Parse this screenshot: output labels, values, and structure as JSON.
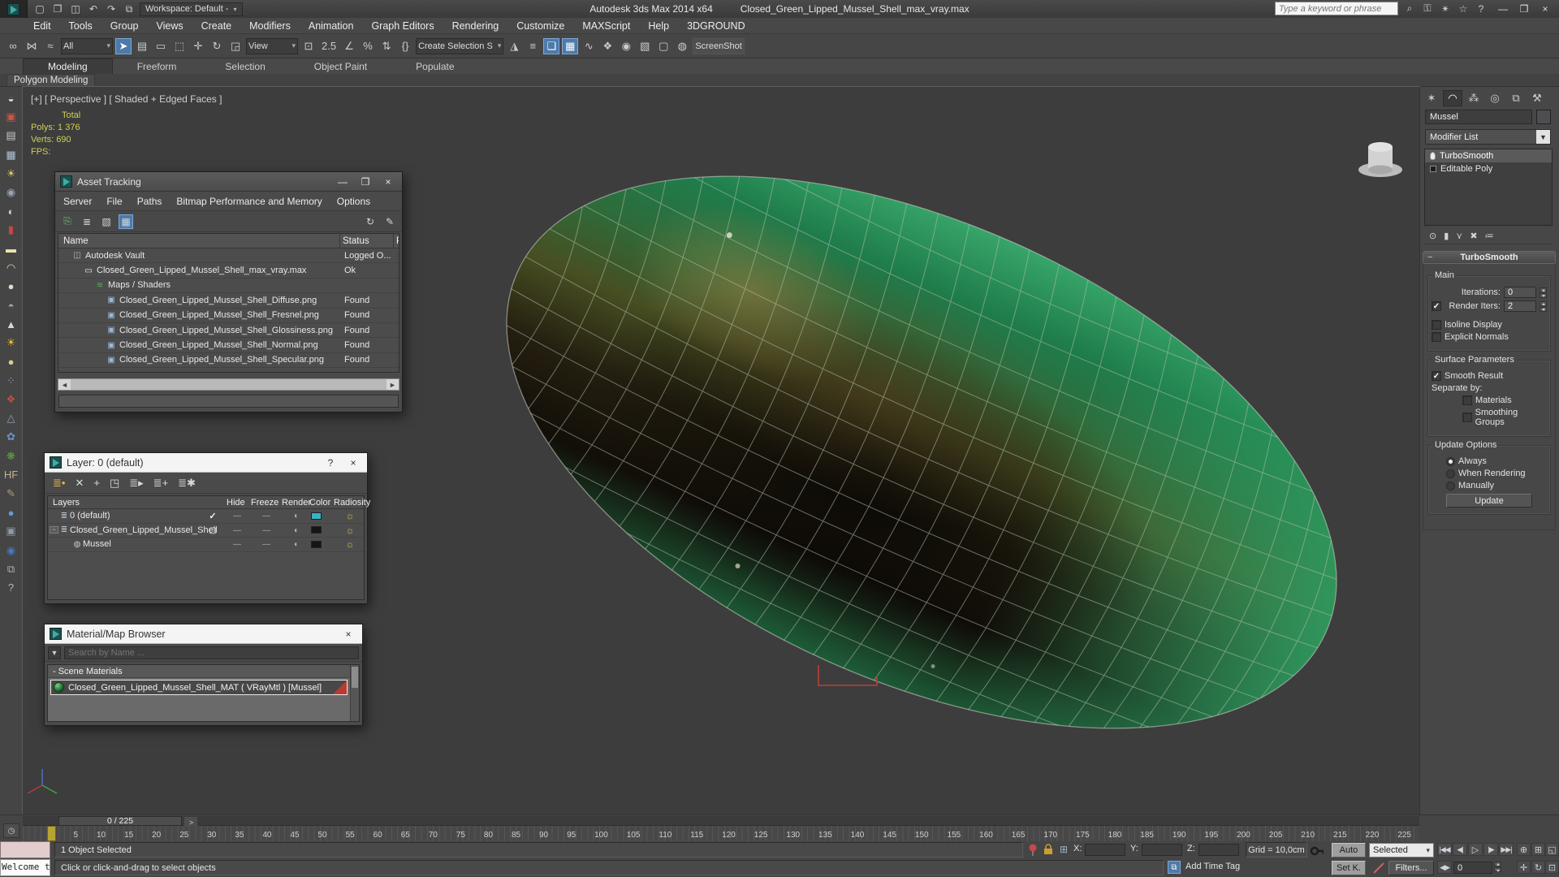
{
  "colors": {
    "accent_blue": "#4d7aa9",
    "stats_yellow": "#cfcf5a",
    "layer_default_color": "#35b5c4",
    "layer_dark_color": "#161616",
    "material_flag_red": "#b83b2e",
    "shell_green": "#2e9e62"
  },
  "titlebar": {
    "app_title": "Autodesk 3ds Max  2014 x64",
    "document_title": "Closed_Green_Lipped_Mussel_Shell_max_vray.max",
    "workspace": "Workspace: Default -",
    "search_placeholder": "Type a keyword or phrase",
    "minimize": "—",
    "maximize": "❐",
    "close": "×"
  },
  "menubar": {
    "items": [
      "Edit",
      "Tools",
      "Group",
      "Views",
      "Create",
      "Modifiers",
      "Animation",
      "Graph Editors",
      "Rendering",
      "Customize",
      "MAXScript",
      "Help",
      "3DGROUND"
    ]
  },
  "toolbar": {
    "items": [
      {
        "name": "select-and-link-icon",
        "glyph": "∞"
      },
      {
        "name": "unlink-selection-icon",
        "glyph": "⋈"
      },
      {
        "name": "bind-to-space-warp-icon",
        "glyph": "≈"
      },
      {
        "name": "selection-filter-dropdown",
        "kind": "dropdown",
        "label": "All"
      },
      {
        "name": "select-object-button",
        "glyph": "➤",
        "active": "true"
      },
      {
        "name": "select-by-name-button",
        "glyph": "▤"
      },
      {
        "name": "rectangular-selection-button",
        "glyph": "▭"
      },
      {
        "name": "window-crossing-toggle",
        "glyph": "⬚"
      },
      {
        "name": "select-and-move-button",
        "glyph": "✛"
      },
      {
        "name": "select-and-rotate-button",
        "glyph": "↻"
      },
      {
        "name": "select-and-scale-button",
        "glyph": "◲"
      },
      {
        "name": "reference-coordinate-dropdown",
        "kind": "dropdown",
        "label": "View"
      },
      {
        "name": "use-pivot-center-button",
        "glyph": "⊡"
      },
      {
        "name": "snaps-toggle",
        "glyph": "2.5"
      },
      {
        "name": "angle-snap-toggle",
        "glyph": "∠"
      },
      {
        "name": "percent-snap-toggle",
        "glyph": "%"
      },
      {
        "name": "spinner-snap-toggle",
        "glyph": "⇅"
      },
      {
        "name": "keyboard-override-toggle",
        "glyph": "{}"
      },
      {
        "name": "named-selection-set-field",
        "kind": "dropdown",
        "label": "Create Selection S"
      },
      {
        "name": "mirror-button",
        "glyph": "◮"
      },
      {
        "name": "align-button",
        "glyph": "≡"
      },
      {
        "name": "layer-manager-button",
        "glyph": "❏",
        "active": "true"
      },
      {
        "name": "graphite-ribbon-toggle",
        "glyph": "▦",
        "active": "true"
      },
      {
        "name": "curve-editor-button",
        "glyph": "∿"
      },
      {
        "name": "schematic-view-button",
        "glyph": "❖"
      },
      {
        "name": "material-editor-button",
        "glyph": "◉"
      },
      {
        "name": "render-setup-button",
        "glyph": "▧"
      },
      {
        "name": "rendered-frame-window-button",
        "glyph": "▢"
      },
      {
        "name": "render-production-button",
        "glyph": "◍"
      },
      {
        "name": "screenshot-button",
        "kind": "label",
        "label": "ScreenShot"
      }
    ]
  },
  "ribbon": {
    "tabs": [
      {
        "label": "Modeling",
        "active": "true"
      },
      {
        "label": "Freeform",
        "active": ""
      },
      {
        "label": "Selection",
        "active": ""
      },
      {
        "label": "Object Paint",
        "active": ""
      },
      {
        "label": "Populate",
        "active": ""
      }
    ],
    "subtab": "Polygon Modeling"
  },
  "left_toolbar": {
    "icons": [
      {
        "name": "teapot-render-icon",
        "glyph": "◒",
        "color": "#d8dce4"
      },
      {
        "name": "render-frame-icon",
        "glyph": "▣",
        "color": "#cc5544"
      },
      {
        "name": "render-setup-icon",
        "glyph": "▤",
        "color": "#c8c8c8"
      },
      {
        "name": "spreadsheet-icon",
        "glyph": "▦",
        "color": "#b0c4d8"
      },
      {
        "name": "light-lister-icon",
        "glyph": "☀",
        "color": "#e8d060"
      },
      {
        "name": "camera-icon",
        "glyph": "◉",
        "color": "#9aa4b0"
      },
      {
        "name": "light-icon",
        "glyph": "◐",
        "color": "#d0d0d0"
      },
      {
        "name": "battery-icon",
        "glyph": "▮",
        "color": "#cc4444"
      },
      {
        "name": "plane-icon",
        "glyph": "▬",
        "color": "#e8e4b0"
      },
      {
        "name": "dome-icon",
        "glyph": "◠",
        "color": "#d8d0a8"
      },
      {
        "name": "disc-icon",
        "glyph": "●",
        "color": "#e0dcc8"
      },
      {
        "name": "teapot-icon",
        "glyph": "◓",
        "color": "#a8a890"
      },
      {
        "name": "mountain-icon",
        "glyph": "▲",
        "color": "#d8d8d8"
      },
      {
        "name": "sun-icon",
        "glyph": "☀",
        "color": "#f0c030"
      },
      {
        "name": "sphere-icon",
        "glyph": "●",
        "color": "#d8cc90"
      },
      {
        "name": "scatter-icon",
        "glyph": "⁘",
        "color": "#88a0c0"
      },
      {
        "name": "molecule-icon",
        "glyph": "❖",
        "color": "#c05040"
      },
      {
        "name": "pyramid-icon",
        "glyph": "△",
        "color": "#90a0b0"
      },
      {
        "name": "flowers-icon",
        "glyph": "✿",
        "color": "#7090c8"
      },
      {
        "name": "grass-icon",
        "glyph": "❋",
        "color": "#60a840"
      },
      {
        "name": "heightfield-icon",
        "glyph": "HF",
        "color": "#c8b090"
      },
      {
        "name": "brush-icon",
        "glyph": "✎",
        "color": "#b09878"
      },
      {
        "name": "blue-sphere-icon",
        "glyph": "●",
        "color": "#6898d0"
      },
      {
        "name": "config-icon",
        "glyph": "▣",
        "color": "#9098a8"
      },
      {
        "name": "spheres-icon",
        "glyph": "◉",
        "color": "#4878c0"
      },
      {
        "name": "display-icon",
        "glyph": "⧉",
        "color": "#a8b0b8"
      },
      {
        "name": "help-icon",
        "glyph": "?",
        "color": "#b8b8b8"
      }
    ]
  },
  "viewport": {
    "label": "[+] [ Perspective ] [ Shaded + Edged Faces ]",
    "stats": {
      "total_label": "Total",
      "polys_label": "Polys:",
      "polys_value": "1 376",
      "verts_label": "Verts:",
      "verts_value": "690",
      "fps_label": "FPS:"
    }
  },
  "asset_tracking": {
    "title": "Asset Tracking",
    "menu": [
      "Server",
      "File",
      "Paths",
      "Bitmap Performance and Memory",
      "Options"
    ],
    "name_col": "Name",
    "status_col": "Status",
    "p_col": "P",
    "rows": [
      {
        "icon": "vault",
        "level": "1",
        "name": "Autodesk Vault",
        "status": "Logged O..."
      },
      {
        "icon": "maxfile",
        "level": "2",
        "name": "Closed_Green_Lipped_Mussel_Shell_max_vray.max",
        "status": "Ok"
      },
      {
        "icon": "maps",
        "level": "3",
        "name": "Maps / Shaders",
        "status": ""
      },
      {
        "icon": "bitmap",
        "level": "4",
        "name": "Closed_Green_Lipped_Mussel_Shell_Diffuse.png",
        "status": "Found"
      },
      {
        "icon": "bitmap",
        "level": "4",
        "name": "Closed_Green_Lipped_Mussel_Shell_Fresnel.png",
        "status": "Found"
      },
      {
        "icon": "bitmap",
        "level": "4",
        "name": "Closed_Green_Lipped_Mussel_Shell_Glossiness.png",
        "status": "Found"
      },
      {
        "icon": "bitmap",
        "level": "4",
        "name": "Closed_Green_Lipped_Mussel_Shell_Normal.png",
        "status": "Found"
      },
      {
        "icon": "bitmap",
        "level": "4",
        "name": "Closed_Green_Lipped_Mussel_Shell_Specular.png",
        "status": "Found"
      }
    ]
  },
  "layer_window": {
    "title": "Layer: 0 (default)",
    "help_button": "?",
    "close_button": "×",
    "layers_col": "Layers",
    "hide_col": "Hide",
    "freeze_col": "Freeze",
    "render_col": "Render",
    "color_col": "Color",
    "radiosity_col": "Radiosity",
    "rows": [
      {
        "expand": "",
        "icon": "layer",
        "level": "0",
        "name": "0 (default)",
        "current": "check",
        "color": "#35b5c4"
      },
      {
        "expand": "−",
        "icon": "layer",
        "level": "0",
        "name": "Closed_Green_Lipped_Mussel_Shell",
        "current": "box",
        "color": "#161616"
      },
      {
        "expand": "",
        "icon": "object",
        "level": "1",
        "name": "Mussel",
        "current": "",
        "color": "#161616"
      }
    ]
  },
  "material_browser": {
    "title": "Material/Map Browser",
    "close_button": "×",
    "search_placeholder": "Search by Name ...",
    "section_label": "- Scene Materials",
    "item_label": "Closed_Green_Lipped_Mussel_Shell_MAT ( VRayMtl ) [Mussel]"
  },
  "command_panel": {
    "tabs": [
      {
        "name": "tab-create",
        "glyph": "✶",
        "active": ""
      },
      {
        "name": "tab-modify",
        "glyph": "◠",
        "active": "true"
      },
      {
        "name": "tab-hierarchy",
        "glyph": "⁂",
        "active": ""
      },
      {
        "name": "tab-motion",
        "glyph": "◎",
        "active": ""
      },
      {
        "name": "tab-display",
        "glyph": "⧉",
        "active": ""
      },
      {
        "name": "tab-utilities",
        "glyph": "⚒",
        "active": ""
      }
    ],
    "object_name": "Mussel",
    "modifier_list_label": "Modifier List",
    "modifiers": [
      {
        "name": "TurboSmooth",
        "icon": "bulb",
        "active": "true"
      },
      {
        "name": "Editable Poly",
        "icon": "box",
        "active": ""
      }
    ],
    "turbosmooth": {
      "rollout_title": "TurboSmooth",
      "main_label": "Main",
      "iterations_label": "Iterations:",
      "iterations_value": "0",
      "render_iters_label": "Render Iters:",
      "render_iters_value": "2",
      "isoline_label": "Isoline Display",
      "explicit_label": "Explicit Normals",
      "surface_label": "Surface Parameters",
      "smooth_result_label": "Smooth Result",
      "separate_label": "Separate by:",
      "materials_label": "Materials",
      "smoothing_groups_label": "Smoothing Groups",
      "update_options_label": "Update Options",
      "always_label": "Always",
      "when_rendering_label": "When Rendering",
      "manually_label": "Manually",
      "update_button": "Update"
    }
  },
  "timeline": {
    "frame_display": "0 / 225",
    "start": 0,
    "end": 225,
    "step": 5,
    "next_arrow": ">"
  },
  "statusbar": {
    "listener_text": "Welcome to",
    "selection_status": "1 Object Selected",
    "prompt": "Click or click-and-drag to select objects",
    "x_label": "X:",
    "y_label": "Y:",
    "z_label": "Z:",
    "grid_label": "Grid = 10,0cm",
    "add_time_tag_label": "Add Time Tag",
    "auto_key_label": "Auto",
    "set_key_label": "Set K.",
    "key_filter_dropdown": "Selected",
    "filters_button": "Filters...",
    "time_value": "0"
  }
}
